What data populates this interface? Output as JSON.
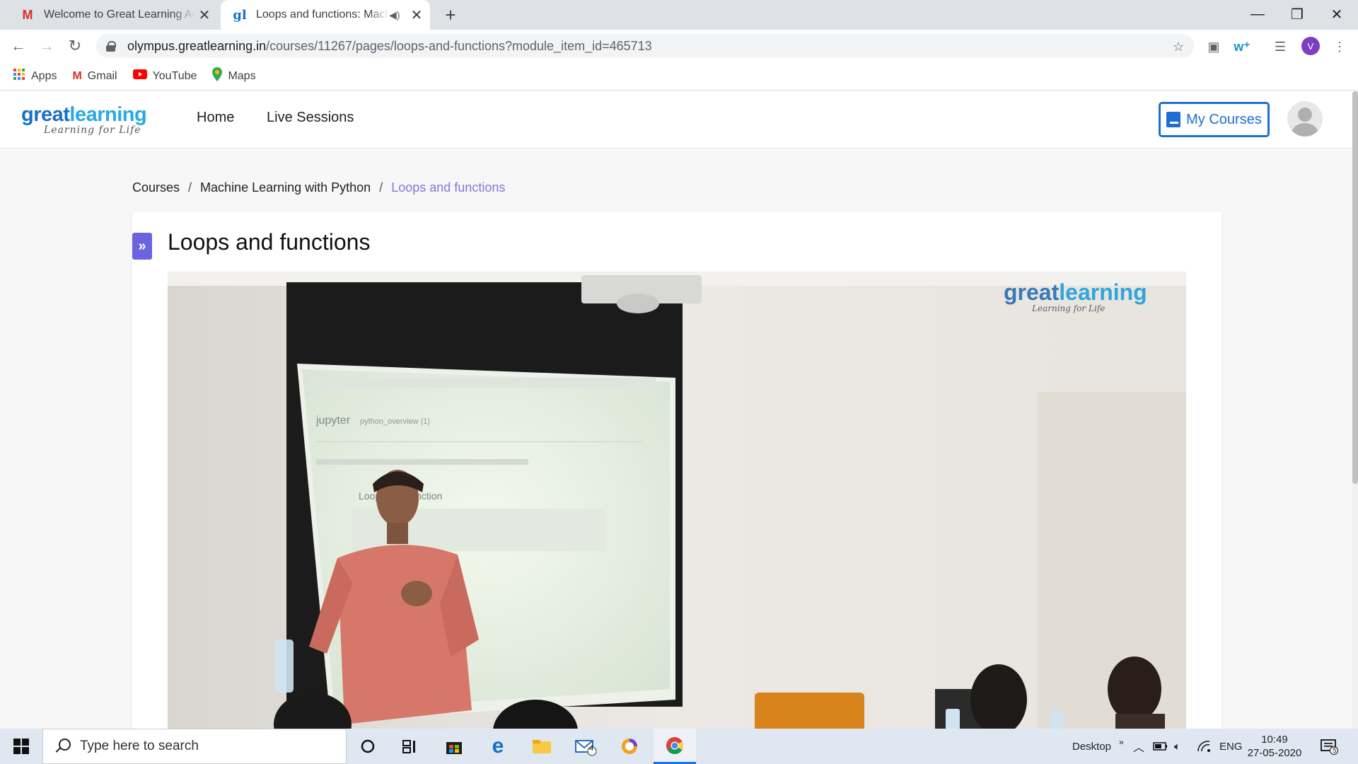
{
  "browser": {
    "tabs": [
      {
        "title": "Welcome to Great Learning Academy",
        "favicon": "gmail-icon",
        "active": false
      },
      {
        "title": "Loops and functions: Machine Learning with Python",
        "favicon": "greatlearning-icon",
        "active": true
      }
    ],
    "url_host": "olympus.greatlearning.in",
    "url_path": "/courses/11267/pages/loops-and-functions?module_item_id=465713",
    "profile_initial": "V",
    "bookmarks": [
      {
        "label": "Apps",
        "icon": "apps-grid-icon"
      },
      {
        "label": "Gmail",
        "icon": "gmail-icon"
      },
      {
        "label": "YouTube",
        "icon": "youtube-icon"
      },
      {
        "label": "Maps",
        "icon": "maps-pin-icon"
      }
    ]
  },
  "site": {
    "logo_main": "great",
    "logo_accent": "learning",
    "logo_tagline": "Learning for Life",
    "nav": [
      "Home",
      "Live Sessions"
    ],
    "my_courses_label": "My Courses"
  },
  "breadcrumb": {
    "items": [
      "Courses",
      "Machine Learning with Python"
    ],
    "current": "Loops and functions",
    "separator": "/"
  },
  "page": {
    "title": "Loops and functions"
  },
  "video": {
    "watermark_main": "great",
    "watermark_accent": "learning",
    "watermark_tagline": "Learning for Life",
    "screen_app": "jupyter",
    "screen_file": "python_overview (1)",
    "screen_heading": "Loops and function"
  },
  "taskbar": {
    "search_placeholder": "Type here to search",
    "desktop_label": "Desktop",
    "language": "ENG",
    "time": "10:49",
    "date": "27-05-2020",
    "mail_badge": "4",
    "notification_badge": "5"
  },
  "colors": {
    "brand_blue": "#1e6fd0",
    "accent_purple": "#6c63e0",
    "breadcrumb_current": "#8b74d8"
  }
}
